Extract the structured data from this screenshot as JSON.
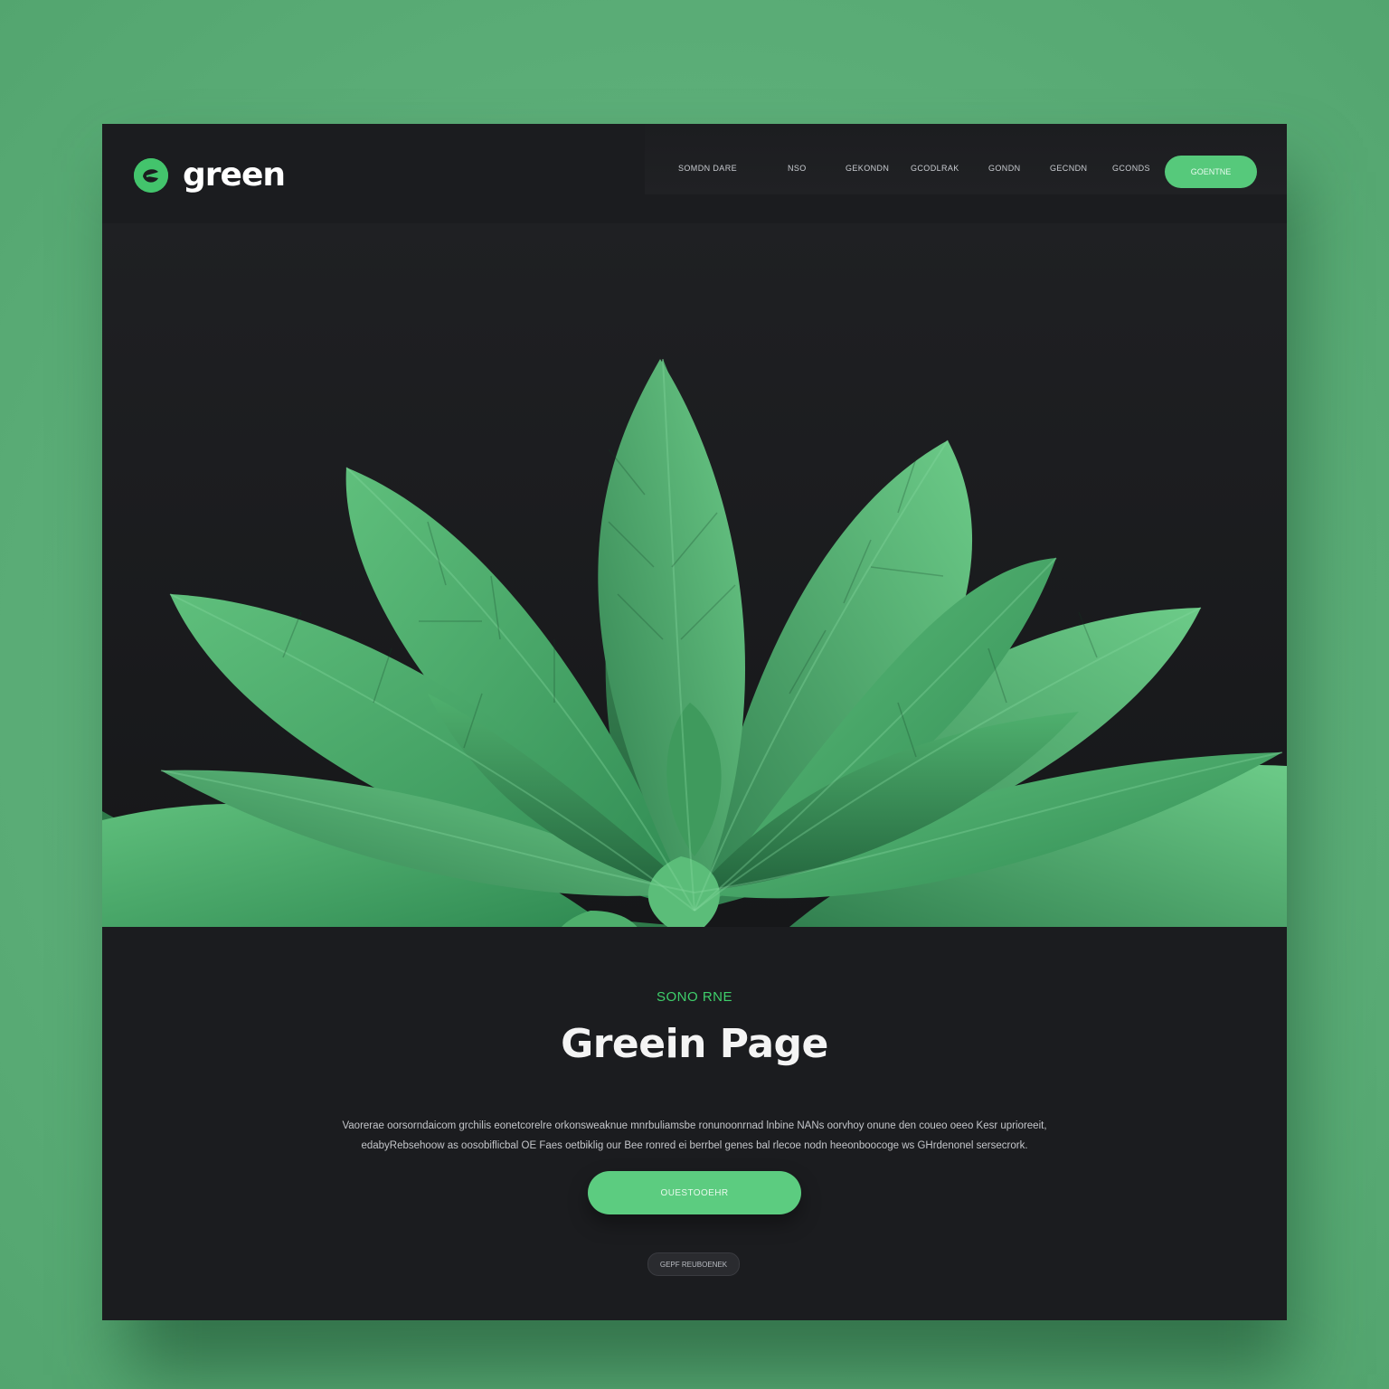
{
  "brand": {
    "name": "green",
    "logo_icon": "leaf-circle-icon",
    "accent_color": "#43c46c"
  },
  "nav": {
    "items": [
      "SOMDN DARE",
      "NSO",
      "GEKONDN",
      "GCODLRAK",
      "GONDN",
      "GECNDN",
      "GCONDS"
    ],
    "cta_label": "GOENTNE"
  },
  "hero": {
    "image": "green-leaves-plant-illustration"
  },
  "content": {
    "eyebrow": "SONO RNE",
    "headline": "Greein Page",
    "body_line_1": "Vaorerae oorsorndaicom grchilis eonetcorelre orkonsweaknue mnrbuliamsbe ronunoonrnad lnbine NANs oorvhoy onune den coueo oeeo Kesr uprioreeit,",
    "body_line_2": "edabyRebsehoow as oosobiflicbal OE Faes oetbiklig our Bee ronred ei berrbel genes bal rlecoe nodn heeonboocoge ws GHrdenonel sersecrork.",
    "cta_label": "OUESTOOEHR",
    "secondary_label": "GEPF REUBOENEK"
  },
  "colors": {
    "page_bg": "#5cae78",
    "window_bg": "#1b1c1f",
    "button_green": "#5ccc80"
  }
}
